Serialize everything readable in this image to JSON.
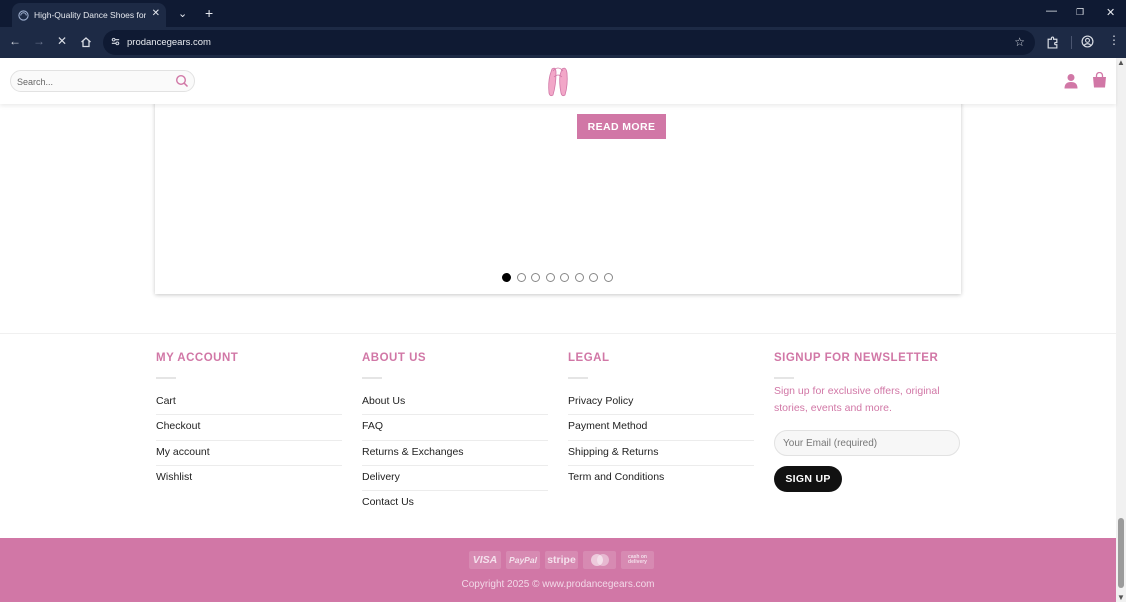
{
  "browser": {
    "tab_title": "High-Quality Dance Shoes for A",
    "url": "prodancegears.com"
  },
  "header": {
    "search_placeholder": "Search..."
  },
  "slider": {
    "read_more_label": "READ MORE",
    "dots_count": 8,
    "active_dot": 0
  },
  "footer": {
    "my_account": {
      "title": "MY ACCOUNT",
      "links": [
        "Cart",
        "Checkout",
        "My account",
        "Wishlist"
      ]
    },
    "about_us": {
      "title": "ABOUT US",
      "links": [
        "About Us",
        "FAQ",
        "Returns & Exchanges",
        "Delivery",
        "Contact Us"
      ]
    },
    "legal": {
      "title": "LEGAL",
      "links": [
        "Privacy Policy",
        "Payment Method",
        "Shipping & Returns",
        "Term and Conditions"
      ]
    },
    "newsletter": {
      "title": "SIGNUP FOR NEWSLETTER",
      "text": "Sign up for exclusive offers, original stories, events and more.",
      "email_placeholder": "Your Email (required)",
      "signup_label": "SIGN UP"
    }
  },
  "bottom_bar": {
    "payment_icons": [
      "VISA",
      "PayPal",
      "stripe",
      "mastercard",
      "cash on delivery"
    ],
    "copyright": "Copyright 2025 © www.prodancegears.com"
  },
  "colors": {
    "brand_pink": "#d177a6",
    "browser_dark": "#0f1a33"
  }
}
